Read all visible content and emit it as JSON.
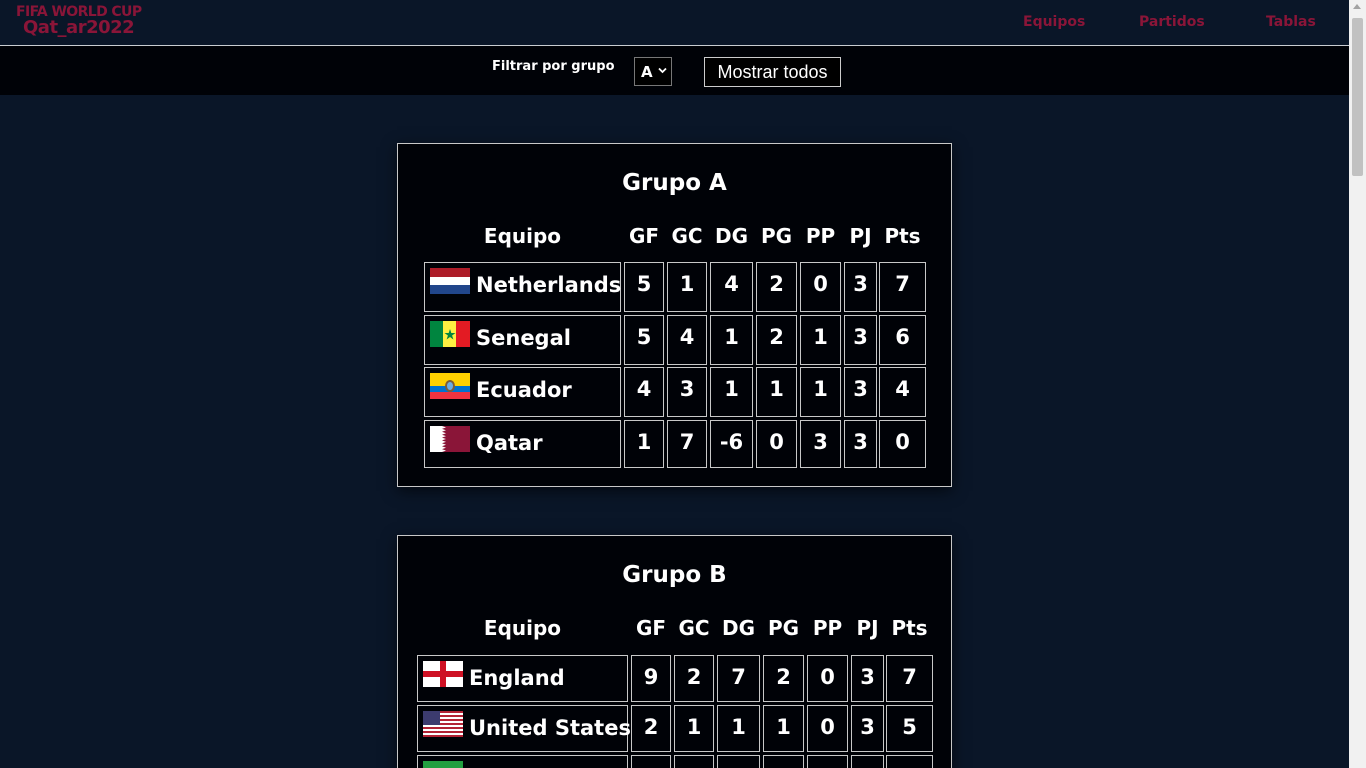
{
  "header": {
    "logo_line1": "FIFA WORLD CUP",
    "logo_line2": "Qat_ar2022",
    "nav": [
      "Equipos",
      "Partidos",
      "Tablas"
    ]
  },
  "filter": {
    "label": "Filtrar por grupo",
    "selected_group": "A",
    "show_all_label": "Mostrar todos"
  },
  "columns": [
    "Equipo",
    "GF",
    "GC",
    "DG",
    "PG",
    "PP",
    "PJ",
    "Pts"
  ],
  "groups": [
    {
      "title": "Grupo A",
      "rows": [
        {
          "team": "Netherlands",
          "flag": "netherlands-flag-icon",
          "gf": "5",
          "gc": "1",
          "dg": "4",
          "pg": "2",
          "pp": "0",
          "pj": "3",
          "pts": "7"
        },
        {
          "team": "Senegal",
          "flag": "senegal-flag-icon",
          "gf": "5",
          "gc": "4",
          "dg": "1",
          "pg": "2",
          "pp": "1",
          "pj": "3",
          "pts": "6"
        },
        {
          "team": "Ecuador",
          "flag": "ecuador-flag-icon",
          "gf": "4",
          "gc": "3",
          "dg": "1",
          "pg": "1",
          "pp": "1",
          "pj": "3",
          "pts": "4"
        },
        {
          "team": "Qatar",
          "flag": "qatar-flag-icon",
          "gf": "1",
          "gc": "7",
          "dg": "-6",
          "pg": "0",
          "pp": "3",
          "pj": "3",
          "pts": "0"
        }
      ]
    },
    {
      "title": "Grupo B",
      "rows": [
        {
          "team": "England",
          "flag": "england-flag-icon",
          "gf": "9",
          "gc": "2",
          "dg": "7",
          "pg": "2",
          "pp": "0",
          "pj": "3",
          "pts": "7"
        },
        {
          "team": "United States",
          "flag": "united-states-flag-icon",
          "gf": "2",
          "gc": "1",
          "dg": "1",
          "pg": "1",
          "pp": "0",
          "pj": "3",
          "pts": "5"
        }
      ]
    }
  ],
  "colors": {
    "background": "#0a1628",
    "card": "#000207",
    "brand": "#8a1538"
  }
}
